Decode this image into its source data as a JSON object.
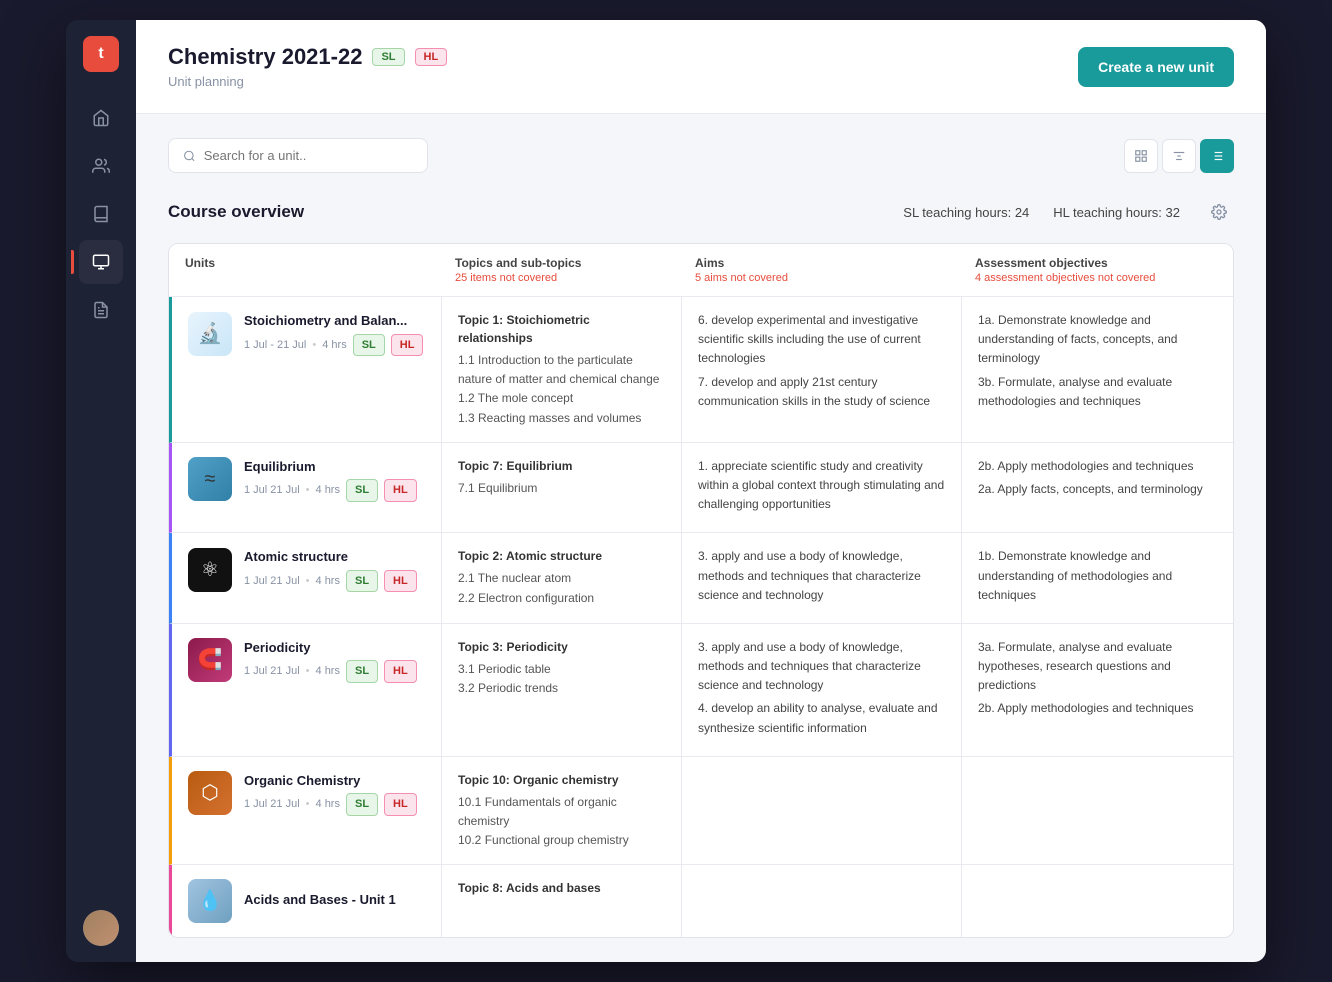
{
  "app": {
    "logo_letter": "t"
  },
  "sidebar": {
    "items": [
      {
        "name": "home",
        "icon": "⌂",
        "active": false
      },
      {
        "name": "users",
        "icon": "👥",
        "active": false
      },
      {
        "name": "book",
        "icon": "📖",
        "active": false
      },
      {
        "name": "monitor",
        "icon": "🖥",
        "active": true
      },
      {
        "name": "notes",
        "icon": "📋",
        "active": false
      }
    ]
  },
  "header": {
    "title": "Chemistry 2021-22",
    "subtitle": "Unit planning",
    "badge_sl": "SL",
    "badge_hl": "HL",
    "create_button": "Create a new unit"
  },
  "search": {
    "placeholder": "Search for a unit.."
  },
  "course_overview": {
    "title": "Course overview",
    "sl_hours_label": "SL teaching hours: 24",
    "hl_hours_label": "HL teaching hours: 32"
  },
  "table": {
    "columns": [
      {
        "label": "Units",
        "sub": ""
      },
      {
        "label": "Topics and sub-topics",
        "sub": "25 items not covered"
      },
      {
        "label": "Aims",
        "sub": "5 aims not covered"
      },
      {
        "label": "Assessment objectives",
        "sub": "4 assessment objectives not covered"
      }
    ],
    "rows": [
      {
        "id": "stoich",
        "unit_name": "Stoichiometry and Balan...",
        "unit_dates": "1 Jul - 21 Jul",
        "unit_hours": "4 hrs",
        "badges": [
          "SL",
          "HL"
        ],
        "topic_title": "Topic 1: Stoichiometric relationships",
        "topic_subs": [
          "1.1 Introduction to the particulate nature of matter and chemical change",
          "1.2 The mole concept",
          "1.3 Reacting masses and volumes"
        ],
        "aims": [
          "6. develop experimental and investigative scientific skills including the use of current technologies",
          "7. develop and apply 21st century communication skills in the study of science"
        ],
        "assess": [
          "1a. Demonstrate knowledge and understanding of facts, concepts, and terminology",
          "3b. Formulate, analyse and evaluate methodologies and techniques"
        ],
        "border_class": "row-border-stoich",
        "thumb_class": "unit-thumb-stoich",
        "thumb_icon": "🔬"
      },
      {
        "id": "equil",
        "unit_name": "Equilibrium",
        "unit_dates": "1 Jul 21 Jul",
        "unit_hours": "4 hrs",
        "badges": [
          "SL",
          "HL"
        ],
        "topic_title": "Topic 7: Equilibrium",
        "topic_subs": [
          "7.1 Equilibrium"
        ],
        "aims": [
          "1. appreciate scientific study and creativity within a global context through stimulating and challenging opportunities"
        ],
        "assess": [
          "2b. Apply methodologies and techniques",
          "2a. Apply facts, concepts, and terminology"
        ],
        "border_class": "row-border-equil",
        "thumb_class": "unit-thumb-equil",
        "thumb_icon": "⚖"
      },
      {
        "id": "atomic",
        "unit_name": "Atomic structure",
        "unit_dates": "1 Jul 21 Jul",
        "unit_hours": "4 hrs",
        "badges": [
          "SL",
          "HL"
        ],
        "topic_title": "Topic 2: Atomic structure",
        "topic_subs": [
          "2.1 The nuclear atom",
          "2.2 Electron configuration"
        ],
        "aims": [
          "3. apply and use a body of knowledge, methods and techniques that characterize science and technology"
        ],
        "assess": [
          "1b. Demonstrate knowledge and understanding of methodologies and techniques"
        ],
        "border_class": "row-border-atomic",
        "thumb_class": "unit-thumb-atomic",
        "thumb_icon": "⚛"
      },
      {
        "id": "period",
        "unit_name": "Periodicity",
        "unit_dates": "1 Jul 21 Jul",
        "unit_hours": "4 hrs",
        "badges": [
          "SL",
          "HL"
        ],
        "topic_title": "Topic 3: Periodicity",
        "topic_subs": [
          "3.1 Periodic table",
          "3.2 Periodic trends"
        ],
        "aims": [
          "3. apply and use a body of knowledge, methods and techniques that characterize science and technology",
          "4. develop an ability to analyse, evaluate and synthesize scientific information"
        ],
        "assess": [
          "3a. Formulate, analyse and evaluate hypotheses, research questions and predictions",
          "2b. Apply methodologies and techniques"
        ],
        "border_class": "row-border-period",
        "thumb_class": "unit-thumb-period",
        "thumb_icon": "🔮"
      },
      {
        "id": "organic",
        "unit_name": "Organic Chemistry",
        "unit_dates": "1 Jul 21 Jul",
        "unit_hours": "4 hrs",
        "badges": [
          "SL",
          "HL"
        ],
        "topic_title": "Topic 10: Organic chemistry",
        "topic_subs": [
          "10.1 Fundamentals of organic chemistry",
          "10.2 Functional group chemistry"
        ],
        "aims": [],
        "assess": [],
        "border_class": "row-border-organic",
        "thumb_class": "unit-thumb-organic",
        "thumb_icon": "🧫"
      },
      {
        "id": "acids",
        "unit_name": "Acids and Bases - Unit 1",
        "unit_dates": "",
        "unit_hours": "",
        "badges": [],
        "topic_title": "Topic 8: Acids and bases",
        "topic_subs": [],
        "aims": [],
        "assess": [],
        "border_class": "row-border-acids",
        "thumb_class": "unit-thumb-acids",
        "thumb_icon": "🧪"
      }
    ]
  }
}
